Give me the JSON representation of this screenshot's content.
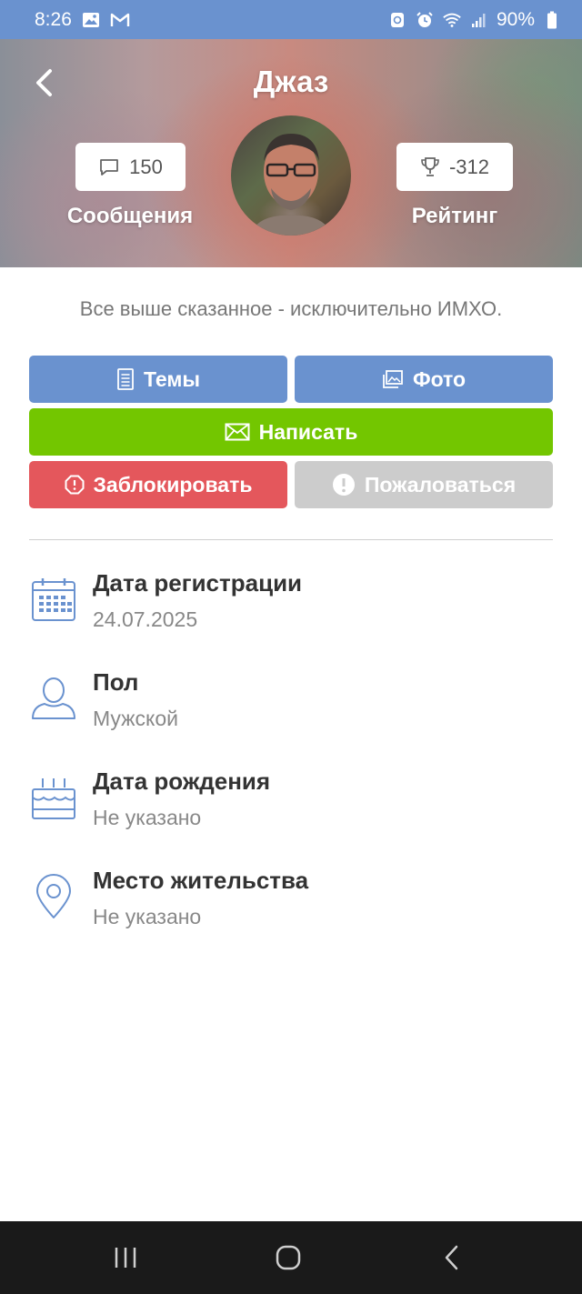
{
  "status_bar": {
    "time": "8:26",
    "battery": "90%",
    "icons": [
      "image-icon",
      "gmail-icon",
      "sync-icon",
      "alarm-icon",
      "wifi-icon",
      "signal-icon",
      "battery-icon"
    ]
  },
  "header": {
    "title": "Джаз",
    "messages_count": "150",
    "messages_label": "Сообщения",
    "rating_value": "-312",
    "rating_label": "Рейтинг"
  },
  "about": "Все выше сказанное - исключительно ИМХО.",
  "buttons": {
    "topics": "Темы",
    "photo": "Фото",
    "write": "Написать",
    "block": "Заблокировать",
    "report": "Пожаловаться"
  },
  "info": [
    {
      "label": "Дата регистрации",
      "value": "24.07.2025",
      "icon": "calendar-icon"
    },
    {
      "label": "Пол",
      "value": "Мужской",
      "icon": "person-icon"
    },
    {
      "label": "Дата рождения",
      "value": "Не указано",
      "icon": "cake-icon"
    },
    {
      "label": "Место жительства",
      "value": "Не указано",
      "icon": "location-pin-icon"
    }
  ],
  "colors": {
    "accent_blue": "#6a92cf",
    "green": "#73c600",
    "red": "#e4575c",
    "gray": "#cccccc"
  }
}
